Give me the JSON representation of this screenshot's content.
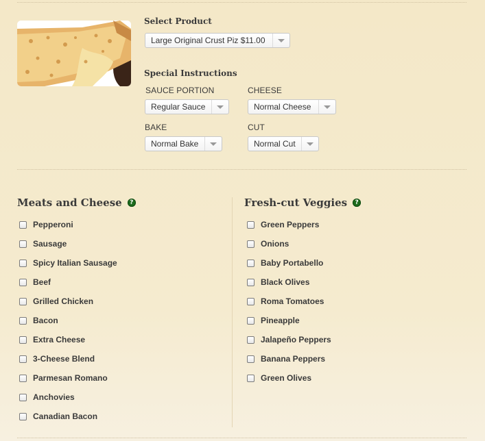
{
  "product": {
    "heading": "Select Product",
    "selected": "Large Original Crust Piz $11.00"
  },
  "instructions": {
    "heading": "Special Instructions",
    "sauce": {
      "label": "SAUCE PORTION",
      "value": "Regular Sauce"
    },
    "cheese": {
      "label": "CHEESE",
      "value": "Normal Cheese"
    },
    "bake": {
      "label": "BAKE",
      "value": "Normal Bake"
    },
    "cut": {
      "label": "CUT",
      "value": "Normal Cut"
    }
  },
  "meats": {
    "title": "Meats and Cheese",
    "help": "?",
    "items": [
      "Pepperoni",
      "Sausage",
      "Spicy Italian Sausage",
      "Beef",
      "Grilled Chicken",
      "Bacon",
      "Extra Cheese",
      "3-Cheese Blend",
      "Parmesan Romano",
      "Anchovies",
      "Canadian Bacon"
    ]
  },
  "veggies": {
    "title": "Fresh-cut Veggies",
    "help": "?",
    "items": [
      "Green Peppers",
      "Onions",
      "Baby Portabello",
      "Black Olives",
      "Roma Tomatoes",
      "Pineapple",
      "Jalapeño Peppers",
      "Banana Peppers",
      "Green Olives"
    ]
  },
  "colors": {
    "help_icon": "#1d6b1d",
    "background": "#f4e8c8"
  },
  "icons": {
    "dropdown": "chevron-down-icon",
    "help": "help-icon"
  }
}
